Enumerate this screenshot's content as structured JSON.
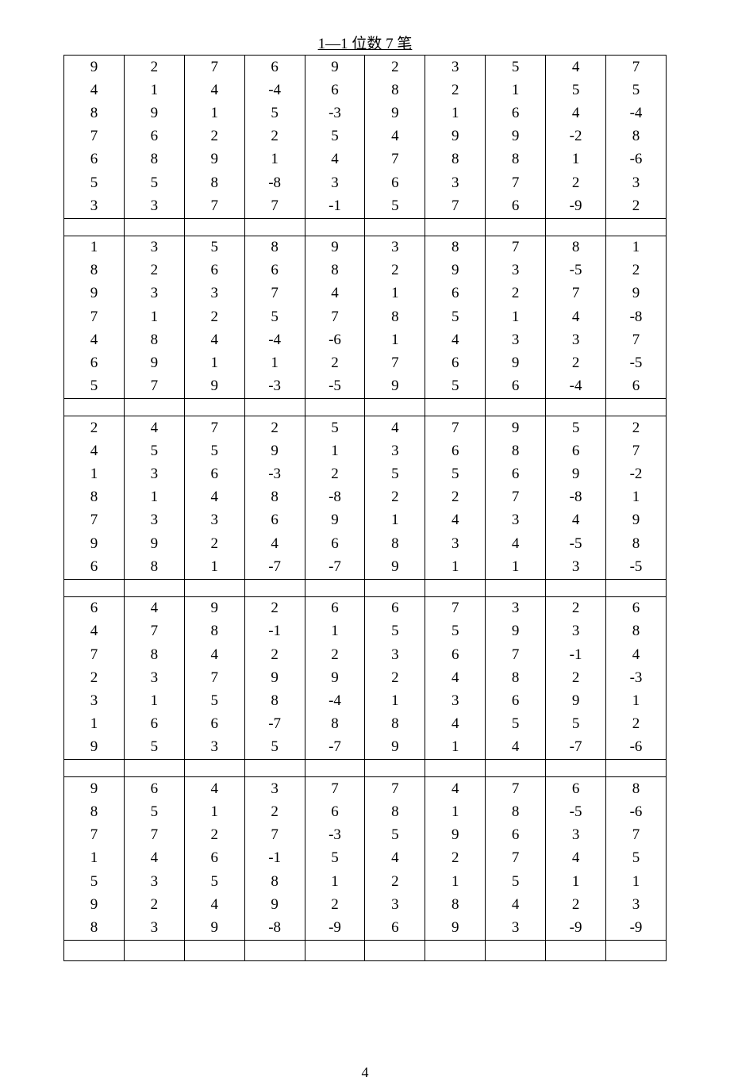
{
  "title": "1—1 位数 7 笔",
  "page_number": "4",
  "chart_data": {
    "type": "table",
    "title": "1—1 位数 7 笔",
    "columns": 10,
    "rows_per_group": 7,
    "groups": [
      [
        [
          "9",
          "2",
          "7",
          "6",
          "9",
          "2",
          "3",
          "5",
          "4",
          "7"
        ],
        [
          "4",
          "1",
          "4",
          "-4",
          "6",
          "8",
          "2",
          "1",
          "5",
          "5"
        ],
        [
          "8",
          "9",
          "1",
          "5",
          "-3",
          "9",
          "1",
          "6",
          "4",
          "-4"
        ],
        [
          "7",
          "6",
          "2",
          "2",
          "5",
          "4",
          "9",
          "9",
          "-2",
          "8"
        ],
        [
          "6",
          "8",
          "9",
          "1",
          "4",
          "7",
          "8",
          "8",
          "1",
          "-6"
        ],
        [
          "5",
          "5",
          "8",
          "-8",
          "3",
          "6",
          "3",
          "7",
          "2",
          "3"
        ],
        [
          "3",
          "3",
          "7",
          "7",
          "-1",
          "5",
          "7",
          "6",
          "-9",
          "2"
        ]
      ],
      [
        [
          "1",
          "3",
          "5",
          "8",
          "9",
          "3",
          "8",
          "7",
          "8",
          "1"
        ],
        [
          "8",
          "2",
          "6",
          "6",
          "8",
          "2",
          "9",
          "3",
          "-5",
          "2"
        ],
        [
          "9",
          "3",
          "3",
          "7",
          "4",
          "1",
          "6",
          "2",
          "7",
          "9"
        ],
        [
          "7",
          "1",
          "2",
          "5",
          "7",
          "8",
          "5",
          "1",
          "4",
          "-8"
        ],
        [
          "4",
          "8",
          "4",
          "-4",
          "-6",
          "1",
          "4",
          "3",
          "3",
          "7"
        ],
        [
          "6",
          "9",
          "1",
          "1",
          "2",
          "7",
          "6",
          "9",
          "2",
          "-5"
        ],
        [
          "5",
          "7",
          "9",
          "-3",
          "-5",
          "9",
          "5",
          "6",
          "-4",
          "6"
        ]
      ],
      [
        [
          "2",
          "4",
          "7",
          "2",
          "5",
          "4",
          "7",
          "9",
          "5",
          "2"
        ],
        [
          "4",
          "5",
          "5",
          "9",
          "1",
          "3",
          "6",
          "8",
          "6",
          "7"
        ],
        [
          "1",
          "3",
          "6",
          "-3",
          "2",
          "5",
          "5",
          "6",
          "9",
          "-2"
        ],
        [
          "8",
          "1",
          "4",
          "8",
          "-8",
          "2",
          "2",
          "7",
          "-8",
          "1"
        ],
        [
          "7",
          "3",
          "3",
          "6",
          "9",
          "1",
          "4",
          "3",
          "4",
          "9"
        ],
        [
          "9",
          "9",
          "2",
          "4",
          "6",
          "8",
          "3",
          "4",
          "-5",
          "8"
        ],
        [
          "6",
          "8",
          "1",
          "-7",
          "-7",
          "9",
          "1",
          "1",
          "3",
          "-5"
        ]
      ],
      [
        [
          "6",
          "4",
          "9",
          "2",
          "6",
          "6",
          "7",
          "3",
          "2",
          "6"
        ],
        [
          "4",
          "7",
          "8",
          "-1",
          "1",
          "5",
          "5",
          "9",
          "3",
          "8"
        ],
        [
          "7",
          "8",
          "4",
          "2",
          "2",
          "3",
          "6",
          "7",
          "-1",
          "4"
        ],
        [
          "2",
          "3",
          "7",
          "9",
          "9",
          "2",
          "4",
          "8",
          "2",
          "-3"
        ],
        [
          "3",
          "1",
          "5",
          "8",
          "-4",
          "1",
          "3",
          "6",
          "9",
          "1"
        ],
        [
          "1",
          "6",
          "6",
          "-7",
          "8",
          "8",
          "4",
          "5",
          "5",
          "2"
        ],
        [
          "9",
          "5",
          "3",
          "5",
          "-7",
          "9",
          "1",
          "4",
          "-7",
          "-6"
        ]
      ],
      [
        [
          "9",
          "6",
          "4",
          "3",
          "7",
          "7",
          "4",
          "7",
          "6",
          "8"
        ],
        [
          "8",
          "5",
          "1",
          "2",
          "6",
          "8",
          "1",
          "8",
          "-5",
          "-6"
        ],
        [
          "7",
          "7",
          "2",
          "7",
          "-3",
          "5",
          "9",
          "6",
          "3",
          "7"
        ],
        [
          "1",
          "4",
          "6",
          "-1",
          "5",
          "4",
          "2",
          "7",
          "4",
          "5"
        ],
        [
          "5",
          "3",
          "5",
          "8",
          "1",
          "2",
          "1",
          "5",
          "1",
          "1"
        ],
        [
          "9",
          "2",
          "4",
          "9",
          "2",
          "3",
          "8",
          "4",
          "2",
          "3"
        ],
        [
          "8",
          "3",
          "9",
          "-8",
          "-9",
          "6",
          "9",
          "3",
          "-9",
          "-9"
        ]
      ]
    ]
  }
}
